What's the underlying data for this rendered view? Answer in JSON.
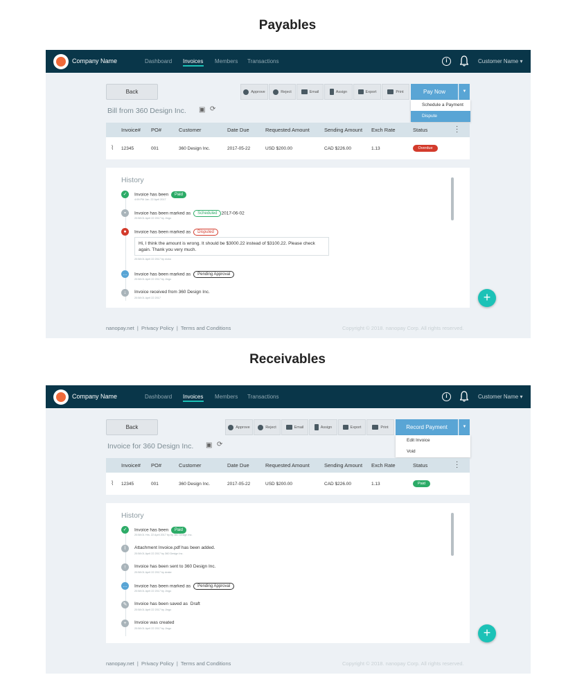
{
  "colors": {
    "topbar": "#093649",
    "accent": "#1cc2b7",
    "primary": "#59a5d5",
    "paid": "#2cab67",
    "overdue": "#d33b2c"
  },
  "payables": {
    "section_title": "Payables",
    "header": {
      "company": "Company Name",
      "nav": [
        "Dashboard",
        "Invoices",
        "Members",
        "Transactions"
      ],
      "active_nav": "Invoices",
      "customer": "Customer Name ▾"
    },
    "back_label": "Back",
    "toolbar": [
      "Approve",
      "Reject",
      "Email",
      "Assign",
      "Export",
      "Print"
    ],
    "primary_label": "Pay Now",
    "menu": [
      "Schedule a Payment",
      "Dispute"
    ],
    "bill_title": "Bill from 360 Design Inc.",
    "table": {
      "headers": [
        "Invoice#",
        "PO#",
        "Customer",
        "Date Due",
        "Requested Amount",
        "Sending Amount",
        "Exch Rate",
        "Status"
      ],
      "row": [
        "12345",
        "001",
        "360 Design Inc.",
        "2017-05-22",
        "USD $200.00",
        "CAD $226.00",
        "1.13"
      ],
      "status": "Overdue"
    },
    "history": {
      "title": "History",
      "items": [
        {
          "text": "Invoice has been",
          "tag": "Paid",
          "extra": "",
          "sub": "4:09:PM Jan. 22 April 2017"
        },
        {
          "text": "Invoice has been marked as",
          "tag": "Scheduled",
          "extra": "2017-06-02",
          "sub": "20:58:01 April 22 2017 by Jingo"
        },
        {
          "text": "Invoice has been marked as",
          "tag": "Disputed",
          "extra": "",
          "sub": "20:58:01 April 22 2017 by nicko",
          "comment": "Hi, I think the amount is wrong. It should be $3000.22 instead of $3100.22. Please check again. Thank you very much."
        },
        {
          "text": "Invoice has been marked as",
          "tag": "Pending Approval",
          "extra": "",
          "sub": "20:58:01 April 22 2017 by Jingo"
        },
        {
          "text": "Invoice received from 360 Design Inc.",
          "tag": "",
          "extra": "",
          "sub": "20:58:01 April 22 2017"
        }
      ]
    },
    "footer": {
      "left": "nanopay.net  |  Privacy Policy  |  Terms and Conditions",
      "right": "Copyright © 2018. nanopay Corp. All rights reserved."
    }
  },
  "receivables": {
    "section_title": "Receivables",
    "header": {
      "company": "Company Name",
      "nav": [
        "Dashboard",
        "Invoices",
        "Members",
        "Transactions"
      ],
      "active_nav": "Invoices",
      "customer": "Customer Name ▾"
    },
    "back_label": "Back",
    "toolbar": [
      "Approve",
      "Reject",
      "Email",
      "Assign",
      "Export",
      "Print"
    ],
    "primary_label": "Record Payment",
    "menu": [
      "Edit Invoice",
      "Void"
    ],
    "bill_title": "Invoice for 360 Design Inc.",
    "table": {
      "headers": [
        "Invoice#",
        "PO#",
        "Customer",
        "Date Due",
        "Requested Amount",
        "Sending Amount",
        "Exch Rate",
        "Status"
      ],
      "row": [
        "12345",
        "001",
        "360 Design Inc.",
        "2017-05-22",
        "USD $200.00",
        "CAD $226.00",
        "1.13"
      ],
      "status": "Paid"
    },
    "history": {
      "title": "History",
      "items": [
        {
          "text": "Invoice has been",
          "tag": "Paid",
          "extra": "",
          "sub": "20:58:01 Hrs. 22 April 2017 by by 360 Design Inc."
        },
        {
          "text": "Attachment Invoice.pdf has been added.",
          "tag": "",
          "extra": "",
          "sub": "20:58:01 April 22 2017 by 360 Design Inc."
        },
        {
          "text": "Invoice has been sent to 360 Design Inc.",
          "tag": "",
          "extra": "",
          "sub": "20:58:01 April 22 2017 by drake"
        },
        {
          "text": "Invoice has been marked as",
          "tag": "Pending Approval",
          "extra": "",
          "sub": "20:58:01 April 22 2017 by Jingo"
        },
        {
          "text": "Invoice has been saved as",
          "tag": "",
          "extra": "Draft",
          "sub": "20:58:01 April 22 2017 by Jingo"
        },
        {
          "text": "Invoice was created",
          "tag": "",
          "extra": "",
          "sub": "20:58:01 April 22 2017 by Jingo"
        }
      ]
    },
    "footer": {
      "left": "nanopay.net  |  Privacy Policy  |  Terms and Conditions",
      "right": "Copyright © 2018. nanopay Corp. All rights reserved."
    }
  }
}
